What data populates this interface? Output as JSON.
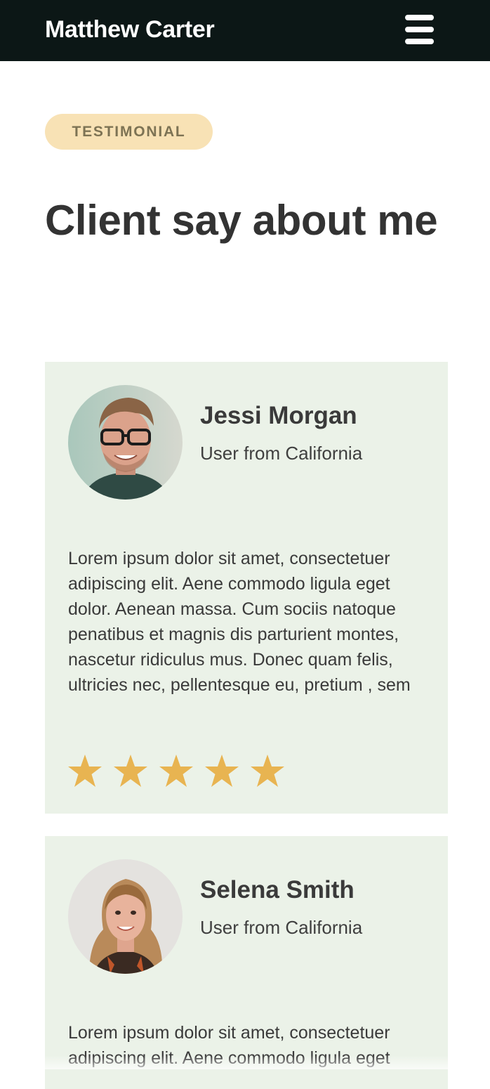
{
  "header": {
    "brand": "Matthew Carter",
    "menu_icon": "hamburger-menu-icon"
  },
  "section": {
    "eyebrow": "TESTIMONIAL",
    "title": "Client say about me"
  },
  "testimonials": [
    {
      "name": "Jessi Morgan",
      "location": "User from California",
      "quote": "Lorem ipsum dolor sit amet, consectetuer adipiscing elit. Aene commodo ligula eget dolor. Aenean massa. Cum sociis natoque penatibus et magnis dis parturient montes, nascetur ridiculus mus. Donec quam felis, ultricies nec, pellentesque eu, pretium , sem",
      "rating": 5,
      "rating_max": 5
    },
    {
      "name": "Selena Smith",
      "location": "User from California",
      "quote": "Lorem ipsum dolor sit amet, consectetuer adipiscing elit. Aene commodo ligula eget"
    }
  ],
  "colors": {
    "topbar": "#0c1716",
    "eyebrow_bg": "#f8e2b5",
    "card_bg": "#ebf2e8",
    "star": "#e8b451"
  }
}
